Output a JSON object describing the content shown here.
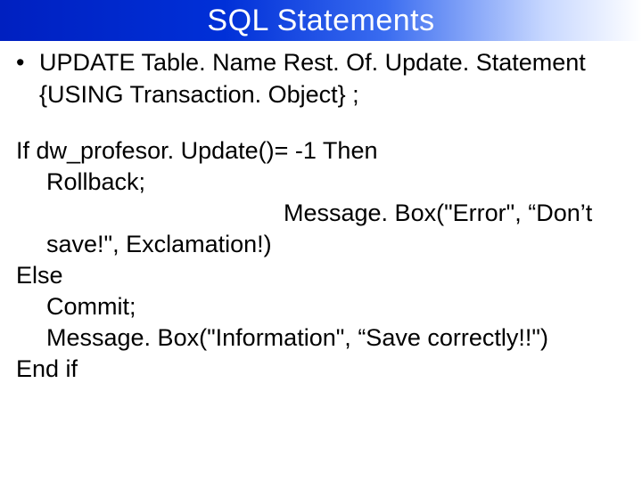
{
  "title": "SQL Statements",
  "bullet": {
    "line1": "UPDATE Table. Name  Rest. Of. Update. Statement",
    "line2": "{USING Transaction. Object} ;"
  },
  "code": {
    "l1": "If dw_profesor. Update()= -1 Then",
    "l2": "Rollback;",
    "l3": "Message. Box(\"Error\", “Don’t",
    "l4": "save!\", Exclamation!)",
    "l5": "Else",
    "l6": "Commit;",
    "l7": "Message. Box(\"Information\", “Save correctly!!\")",
    "l8": "End if"
  }
}
